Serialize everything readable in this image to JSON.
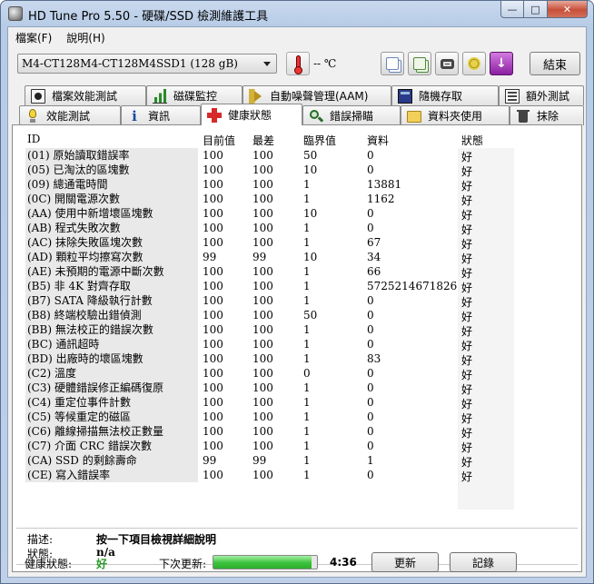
{
  "window": {
    "title": "HD Tune Pro 5.50 - 硬碟/SSD 檢測維護工具",
    "controls": [
      "minimize-icon",
      "maximize-icon",
      "close-icon"
    ]
  },
  "menu": [
    "檔案(F)",
    "說明(H)"
  ],
  "toolbar": {
    "drive": "M4-CT128M4-CT128M4SSD1 (128 gB)",
    "temperature": "-- ℃",
    "icons": [
      "copy-icon",
      "copy-info-icon",
      "screenshot-icon",
      "options-icon",
      "download-icon"
    ],
    "exit_label": "結束"
  },
  "tabs_row1": [
    {
      "label": "檔案效能測試",
      "icon": "file-benchmark-icon"
    },
    {
      "label": "磁碟監控",
      "icon": "disk-monitor-icon"
    },
    {
      "label": "自動噪聲管理(AAM)",
      "icon": "speaker-icon"
    },
    {
      "label": "隨機存取",
      "icon": "random-access-icon"
    },
    {
      "label": "額外測試",
      "icon": "extra-tests-icon"
    }
  ],
  "tabs_row2": [
    {
      "label": "效能測試",
      "icon": "benchmark-icon"
    },
    {
      "label": "資訊",
      "icon": "info-icon"
    },
    {
      "label": "健康狀態",
      "icon": "health-icon"
    },
    {
      "label": "錯誤掃瞄",
      "icon": "error-scan-icon"
    },
    {
      "label": "資料夾使用",
      "icon": "folder-icon"
    },
    {
      "label": "抹除",
      "icon": "erase-icon"
    }
  ],
  "active_tab": "健康狀態",
  "table": {
    "headers": [
      "ID",
      "目前值",
      "最差",
      "臨界值",
      "資料",
      "狀態"
    ],
    "rows": [
      [
        "(01) 原始讀取錯誤率",
        "100",
        "100",
        "50",
        "0",
        "好"
      ],
      [
        "(05) 已淘汰的區塊數",
        "100",
        "100",
        "10",
        "0",
        "好"
      ],
      [
        "(09) 總通電時間",
        "100",
        "100",
        "1",
        "13881",
        "好"
      ],
      [
        "(0C) 開關電源次數",
        "100",
        "100",
        "1",
        "1162",
        "好"
      ],
      [
        "(AA) 使用中新增壞區塊數",
        "100",
        "100",
        "10",
        "0",
        "好"
      ],
      [
        "(AB) 程式失敗次數",
        "100",
        "100",
        "1",
        "0",
        "好"
      ],
      [
        "(AC) 抹除失敗區塊次數",
        "100",
        "100",
        "1",
        "67",
        "好"
      ],
      [
        "(AD) 顆粒平均擦寫次數",
        "99",
        "99",
        "10",
        "34",
        "好"
      ],
      [
        "(AE) 未預期的電源中斷次數",
        "100",
        "100",
        "1",
        "66",
        "好"
      ],
      [
        "(B5) 非 4K 對齊存取",
        "100",
        "100",
        "1",
        "5725214671826",
        "好"
      ],
      [
        "(B7) SATA 降級執行計數",
        "100",
        "100",
        "1",
        "0",
        "好"
      ],
      [
        "(B8) 終端校驗出錯偵測",
        "100",
        "100",
        "50",
        "0",
        "好"
      ],
      [
        "(BB) 無法校正的錯誤次數",
        "100",
        "100",
        "1",
        "0",
        "好"
      ],
      [
        "(BC) 通訊超時",
        "100",
        "100",
        "1",
        "0",
        "好"
      ],
      [
        "(BD) 出廠時的壞區塊數",
        "100",
        "100",
        "1",
        "83",
        "好"
      ],
      [
        "(C2) 溫度",
        "100",
        "100",
        "0",
        "0",
        "好"
      ],
      [
        "(C3) 硬體錯誤修正編碼復原",
        "100",
        "100",
        "1",
        "0",
        "好"
      ],
      [
        "(C4) 重定位事件計數",
        "100",
        "100",
        "1",
        "0",
        "好"
      ],
      [
        "(C5) 等候重定的磁區",
        "100",
        "100",
        "1",
        "0",
        "好"
      ],
      [
        "(C6) 離線掃描無法校正數量",
        "100",
        "100",
        "1",
        "0",
        "好"
      ],
      [
        "(C7) 介面 CRC 錯誤次數",
        "100",
        "100",
        "1",
        "0",
        "好"
      ],
      [
        "(CA) SSD 的剩餘壽命",
        "99",
        "99",
        "1",
        "1",
        "好"
      ],
      [
        "(CE) 寫入錯誤率",
        "100",
        "100",
        "1",
        "0",
        "好"
      ]
    ]
  },
  "description": {
    "label": "描述:",
    "value": "按一下項目檢視詳細說明",
    "status_label": "狀態:",
    "status_value": "n/a"
  },
  "footer": {
    "health_label": "健康狀態:",
    "health_value": "好",
    "next_update_label": "下次更新:",
    "progress_fraction": 0.95,
    "time": "4:36",
    "refresh_label": "更新",
    "log_label": "記錄"
  },
  "colors": {
    "good": "#2a9a2a",
    "progress": "#3ac33a",
    "close": "#c7503a"
  }
}
